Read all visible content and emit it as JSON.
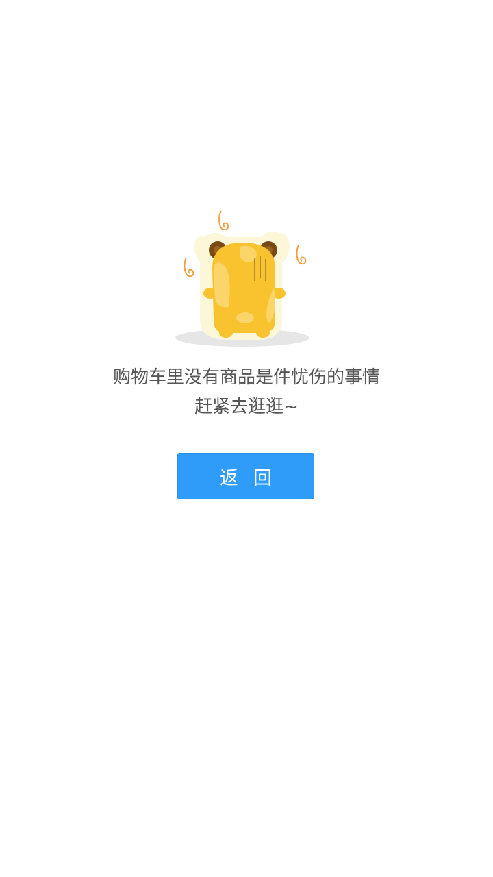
{
  "empty_cart": {
    "illustration_icon": "sad-hamster-icon",
    "message_line1": "购物车里没有商品是件忧伤的事情",
    "message_line2": "赶紧去逛逛~",
    "back_button_label": "返回"
  },
  "colors": {
    "background": "#ffffff",
    "text": "#555555",
    "button_background": "#2f9cf9",
    "button_text": "#ffffff",
    "hamster_body": "#f9c22f",
    "hamster_ears": "#7a4a14",
    "swirl": "#f0a040"
  }
}
